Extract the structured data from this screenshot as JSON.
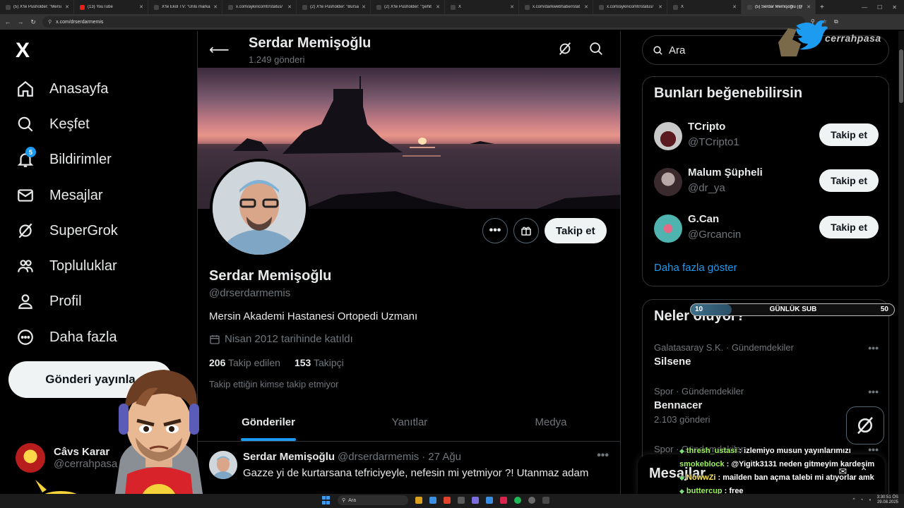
{
  "browser": {
    "tabs": [
      {
        "label": "(5) X'te Pusholder: \"Mersi",
        "active": false
      },
      {
        "label": "(13) YouTube",
        "active": false,
        "icon": "youtube-icon"
      },
      {
        "label": "X'te Ekol TV: \"Ünlü marka",
        "active": false
      },
      {
        "label": "x.com/aykiricomtr/status/",
        "active": false
      },
      {
        "label": "(2) X'te Pusholder: \"Bursa",
        "active": false
      },
      {
        "label": "(2) X'te Pusholder: \"Şehit",
        "active": false
      },
      {
        "label": "X",
        "active": false
      },
      {
        "label": "x.com/darkwebhaber/stat",
        "active": false
      },
      {
        "label": "x.com/aykiricomtr/status/",
        "active": false
      },
      {
        "label": "X",
        "active": false
      },
      {
        "label": "(5) Serdar Memişoğlu (@",
        "active": true
      }
    ],
    "new_tab": "+",
    "url": "x.com/drserdarmemis"
  },
  "nav": {
    "logo": "X",
    "items": [
      {
        "label": "Anasayfa",
        "icon": "home-icon"
      },
      {
        "label": "Keşfet",
        "icon": "search-icon"
      },
      {
        "label": "Bildirimler",
        "icon": "bell-icon",
        "badge": "5"
      },
      {
        "label": "Mesajlar",
        "icon": "mail-icon"
      },
      {
        "label": "SuperGrok",
        "icon": "grok-icon"
      },
      {
        "label": "Topluluklar",
        "icon": "communities-icon"
      },
      {
        "label": "Profil",
        "icon": "person-icon"
      },
      {
        "label": "Daha fazla",
        "icon": "more-circle-icon"
      }
    ],
    "post_button": "Gönderi yayınla",
    "account": {
      "name": "Câvs Karar",
      "handle": "@cerrahpasa"
    }
  },
  "profile": {
    "title": "Serdar Memişoğlu",
    "post_count": "1.249 gönderi",
    "name": "Serdar Memişoğlu",
    "handle": "@drserdarmemis",
    "bio": "Mersin Akademi Hastanesi Ortopedi Uzmanı",
    "joined": "Nisan 2012 tarihinde katıldı",
    "following_count": "206",
    "following_label": "Takip edilen",
    "followers_count": "153",
    "followers_label": "Takipçi",
    "followed_note": "Takip ettiğin kimse takip etmiyor",
    "follow_button": "Takip et",
    "more_button": "•••",
    "tabs": [
      "Gönderiler",
      "Yanıtlar",
      "Medya"
    ]
  },
  "tweet": {
    "name": "Serdar Memişoğlu",
    "handle": "@drserdarmemis",
    "separator": "·",
    "date": "27 Ağu",
    "text": "Gazze yi de kurtarsana tefriciyeyle, nefesin mi yetmiyor ?! Utanmaz adam",
    "more": "•••"
  },
  "sidebar": {
    "search_placeholder": "Ara",
    "suggestions_title": "Bunları beğenebilirsin",
    "suggestions": [
      {
        "name": "TCripto",
        "handle": "@TCripto1",
        "button": "Takip et"
      },
      {
        "name": "Malum Şüpheli",
        "handle": "@dr_ya",
        "button": "Takip et"
      },
      {
        "name": "G.Can",
        "handle": "@Grcancin",
        "button": "Takip et"
      }
    ],
    "show_more": "Daha fazla göster",
    "trends_title": "Neler oluyor?",
    "trends": [
      {
        "meta": "Galatasaray S.K. · Gündemdekiler",
        "title": "Silsene",
        "posts": ""
      },
      {
        "meta": "Spor · Gündemdekiler",
        "title": "Bennacer",
        "posts": "2.103 gönderi"
      },
      {
        "meta": "Spor · Gündemdekiler",
        "title": "",
        "posts": ""
      }
    ],
    "trend_more": "•••",
    "messages_title": "Mesajlar"
  },
  "overlay": {
    "logo_text": "cerrahpasa",
    "sub_goal": {
      "label": "GÜNLÜK SUB",
      "min": "10",
      "max": "50",
      "progress": 0.2
    },
    "chat": [
      {
        "user": "thresh_ustasi",
        "text": ": izlemiyo musun yayınlarımızı",
        "badge": true
      },
      {
        "user": "smokeblock",
        "text": ": @Yigitk3131 neden gitmeyim kardeşim",
        "badge": false
      },
      {
        "user": "NowwZi",
        "text": ": mailden ban açma talebi mi atıyorlar amk",
        "badge": true,
        "yellow": true
      },
      {
        "user": "buttercup",
        "text": ": free",
        "badge": true
      }
    ]
  },
  "taskbar": {
    "search_placeholder": "Ara",
    "time": "3:30:51 ÖS",
    "date": "29.08.2025"
  },
  "colors": {
    "accent": "#1d9bf0",
    "background": "#000000",
    "border": "#2f3336",
    "muted": "#71767b"
  }
}
